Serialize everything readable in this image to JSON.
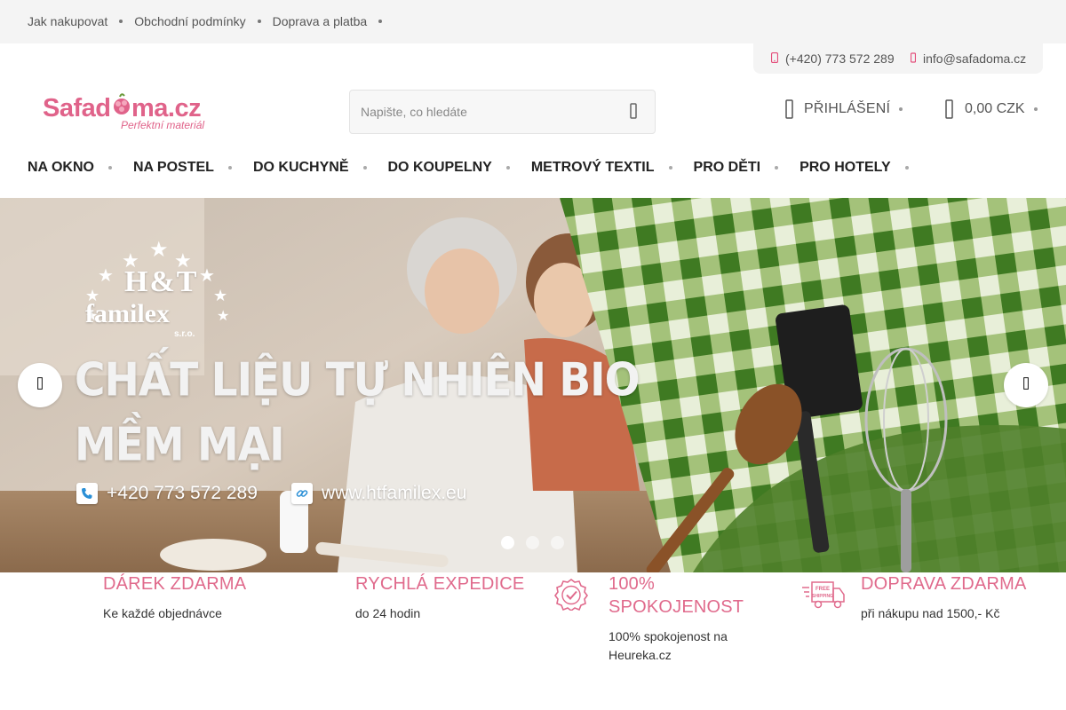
{
  "topbar": {
    "links": [
      "Jak nakupovat",
      "Obchodní podmínky",
      "Doprava a platba"
    ]
  },
  "contact": {
    "phone": "(+420) 773 572 289",
    "email": "info@safadoma.cz"
  },
  "logo": {
    "name": "Safadoma.cz",
    "tagline": "Perfektní materiál"
  },
  "search": {
    "placeholder": "Napište, co hledáte"
  },
  "account": {
    "login_label": "PŘIHLÁŠENÍ",
    "cart_total": "0,00 CZK"
  },
  "nav": {
    "items": [
      "NA OKNO",
      "NA POSTEL",
      "DO KUCHYNĚ",
      "DO KOUPELNY",
      "METROVÝ TEXTIL",
      "PRO DĚTI",
      "PRO HOTELY"
    ]
  },
  "hero": {
    "brand_line1": "H&T",
    "brand_line2": "familex",
    "brand_line3": "s.r.o.",
    "slogan_line1": "CHẤT LIỆU TỰ NHIÊN BIO",
    "slogan_line2": "MỀM MẠI",
    "phone": "+420 773 572 289",
    "website": "www.htfamilex.eu",
    "slide_count": 3,
    "active_slide": 1
  },
  "benefits": [
    {
      "title": "DÁREK ZDARMA",
      "subtitle": "Ke každé objednávce"
    },
    {
      "title": "RYCHLÁ EXPEDICE",
      "subtitle": "do 24 hodin"
    },
    {
      "title": "100% SPOKOJENOST",
      "subtitle": "100% spokojenost na Heureka.cz"
    },
    {
      "title": "DOPRAVA ZDARMA",
      "subtitle": "při nákupu nad 1500,- Kč"
    }
  ],
  "colors": {
    "accent": "#e06a8c",
    "topbar_bg": "#f4f4f4",
    "apron_green": "#4f7f2a"
  },
  "icons": {
    "phone": "phone-icon",
    "email": "mail-icon",
    "search": "search-icon",
    "login": "user-icon",
    "cart": "cart-icon",
    "satisfaction": "badge-check-icon",
    "shipping": "free-shipping-truck-icon"
  }
}
